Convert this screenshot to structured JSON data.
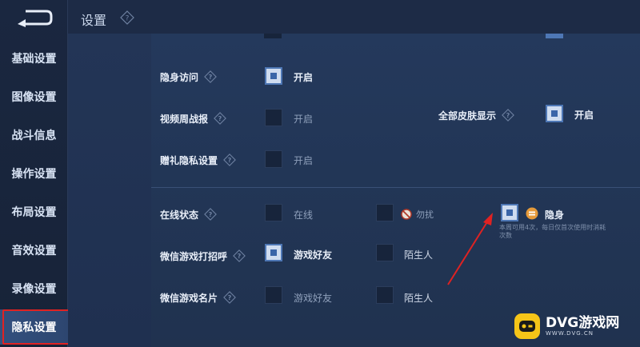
{
  "header": {
    "title": "设置"
  },
  "sidebar": {
    "items": [
      {
        "label": "基础设置"
      },
      {
        "label": "图像设置"
      },
      {
        "label": "战斗信息"
      },
      {
        "label": "操作设置"
      },
      {
        "label": "布局设置"
      },
      {
        "label": "音效设置"
      },
      {
        "label": "录像设置"
      },
      {
        "label": "隐私设置"
      }
    ]
  },
  "settings": {
    "stealth_visit": {
      "label": "隐身访问",
      "option": "开启",
      "checked": true
    },
    "weekly_report": {
      "label": "视频周战报",
      "option": "开启",
      "checked": false
    },
    "gift_privacy": {
      "label": "赠礼隐私设置",
      "option": "开启",
      "checked": false
    },
    "all_skins": {
      "label": "全部皮肤显示",
      "option": "开启",
      "checked": true
    },
    "online_status": {
      "label": "在线状态",
      "options": [
        "在线",
        "勿扰",
        "隐身"
      ],
      "selected": "隐身",
      "note": "本周可用4次，每日仅首次使用时消耗次数"
    },
    "wechat_greeting": {
      "label": "微信游戏打招呼",
      "options": [
        "游戏好友",
        "陌生人"
      ],
      "selected": "游戏好友"
    },
    "wechat_card": {
      "label": "微信游戏名片",
      "options": [
        "游戏好友",
        "陌生人"
      ],
      "selected": ""
    }
  },
  "watermark": {
    "text": "DVG游戏网",
    "sub": "WWW.DVG.CN"
  },
  "colors": {
    "accent": "#3a65a8",
    "highlight": "#e02222"
  }
}
